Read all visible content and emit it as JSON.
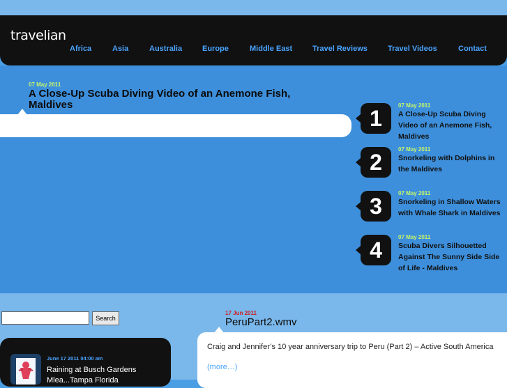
{
  "site": {
    "logo": "travelian"
  },
  "nav": [
    {
      "label": "Africa"
    },
    {
      "label": "Asia"
    },
    {
      "label": "Australia"
    },
    {
      "label": "Europe"
    },
    {
      "label": "Middle East"
    },
    {
      "label": "Travel Reviews"
    },
    {
      "label": "Travel Videos"
    },
    {
      "label": "Contact"
    }
  ],
  "featured": {
    "date": "07 May 2011",
    "title": "A Close-Up Scuba Diving Video of an Anemone Fish, Maldives"
  },
  "popular": [
    {
      "rank": "1",
      "date": "07 May 2011",
      "title": "A Close-Up Scuba Diving Video of an Anemone Fish, Maldives"
    },
    {
      "rank": "2",
      "date": "07 May 2011",
      "title": "Snorkeling with Dolphins in the Maldives"
    },
    {
      "rank": "3",
      "date": "07 May 2011",
      "title": "Snorkeling in Shallow Waters with Whale Shark in Maldives"
    },
    {
      "rank": "4",
      "date": "07 May 2011",
      "title": "Scuba Divers Silhouetted Against The Sunny Side Side of Life - Maldives"
    }
  ],
  "search": {
    "value": "",
    "placeholder": "",
    "button": "Search"
  },
  "recent": {
    "date": "June 17 2011 04:00 am",
    "title": "Raining at Busch Gardens Mlea...Tampa Florida"
  },
  "post": {
    "date": "17 Jun 2011",
    "title": "PeruPart2.wmv",
    "excerpt": "Craig and Jennifer’s 10 year anniversary trip to Peru (Part 2) – Active South America",
    "more": "(more…)"
  },
  "colors": {
    "page_bg": "#4a9ee4",
    "nav_bg": "#111111",
    "nav_link": "#4aa4ff",
    "date_green": "#c6f56b",
    "date_red": "#cc1f1f"
  }
}
